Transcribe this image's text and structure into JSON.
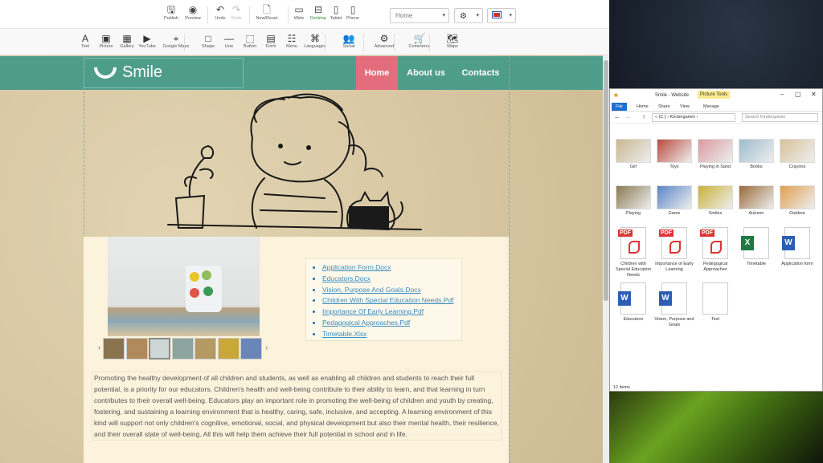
{
  "toolbar": {
    "top": [
      {
        "label": "Publish",
        "icon": "save-icon"
      },
      {
        "label": "Preview",
        "icon": "eye-icon"
      },
      {
        "label": "Undo",
        "icon": "undo-icon"
      },
      {
        "label": "Redo",
        "icon": "redo-icon"
      },
      {
        "label": "New/Reset",
        "icon": "new-page-icon"
      },
      {
        "label": "Wide",
        "icon": "monitor-icon"
      },
      {
        "label": "Desktop",
        "icon": "laptop-icon"
      },
      {
        "label": "Tablet",
        "icon": "tablet-icon"
      },
      {
        "label": "Phone",
        "icon": "phone-icon"
      }
    ],
    "page_select": "Home",
    "insert": [
      {
        "label": "Text",
        "icon": "text-icon",
        "glyph": "A"
      },
      {
        "label": "Picture",
        "icon": "picture-icon",
        "glyph": "▣"
      },
      {
        "label": "Gallery",
        "icon": "gallery-icon",
        "glyph": "▦"
      },
      {
        "label": "YouTube",
        "icon": "youtube-icon",
        "glyph": "▶"
      },
      {
        "label": "Google Maps",
        "icon": "map-pin-icon",
        "glyph": "⌖"
      },
      {
        "label": "Shape",
        "icon": "shape-icon",
        "glyph": "□"
      },
      {
        "label": "Line",
        "icon": "line-icon",
        "glyph": "—"
      },
      {
        "label": "Button",
        "icon": "button-icon",
        "glyph": "⬚"
      },
      {
        "label": "Form",
        "icon": "form-icon",
        "glyph": "▤"
      },
      {
        "label": "Menu",
        "icon": "menu-icon",
        "glyph": "☷"
      },
      {
        "label": "Languages",
        "icon": "languages-icon",
        "glyph": "⌘"
      },
      {
        "label": "Social",
        "icon": "social-icon",
        "glyph": "👥"
      },
      {
        "label": "Advanced",
        "icon": "gears-icon",
        "glyph": "⚙"
      },
      {
        "label": "Commerce",
        "icon": "cart-icon",
        "glyph": "🛒"
      },
      {
        "label": "Maps",
        "icon": "map-icon",
        "glyph": "🗺"
      }
    ]
  },
  "site": {
    "logo": "Smile",
    "nav": [
      "Home",
      "About us",
      "Contacts"
    ],
    "documents": [
      "Application Form.Docx",
      "Educators.Docx",
      "Vision, Purpose And Goals.Docx",
      "Children With Special Education Needs.Pdf",
      "Importance Of Early Learning.Pdf",
      "Pedagogical Approaches.Pdf",
      "Timetable.Xlsx"
    ],
    "paragraph": "Promoting the healthy development of all children and students, as well as enabling all children and students to reach their full potential, is a priority for our educators. Children's health and well-being contribute to their ability to learn, and that learning in turn contributes to their overall well-being. Educators play an important role in promoting the well-being of children and youth by creating, fostering, and sustaining a learning environment that is healthy, caring, safe, inclusive, and accepting. A learning environment of this kind will support not only children's cognitive, emotional, social, and physical development but also their mental health, their resilience, and their overall state of well-being. All this will help them achieve their full potential in school and in life."
  },
  "explorer": {
    "title": "Smile - Website",
    "context_tab": "Picture Tools",
    "ribbon": [
      "File",
      "Home",
      "Share",
      "View",
      "Manage"
    ],
    "path": "« (C:) › Kindergarten ›",
    "search_placeholder": "Search Kindergarten",
    "items": [
      {
        "name": "Girl",
        "kind": "image",
        "color": "#c9b78e"
      },
      {
        "name": "Toys",
        "kind": "image",
        "color": "#b94a3a"
      },
      {
        "name": "Playing in Sand",
        "kind": "image",
        "color": "#d99aa0"
      },
      {
        "name": "Books",
        "kind": "image",
        "color": "#9dbbcc"
      },
      {
        "name": "Crayons",
        "kind": "image",
        "color": "#d7c29a"
      },
      {
        "name": "Playing",
        "kind": "image",
        "color": "#8a7a52"
      },
      {
        "name": "Game",
        "kind": "image",
        "color": "#5a86c6"
      },
      {
        "name": "Smiles",
        "kind": "image",
        "color": "#c9b23a"
      },
      {
        "name": "Autumn",
        "kind": "image",
        "color": "#9a6a3a"
      },
      {
        "name": "Outdoor",
        "kind": "image",
        "color": "#e0a050"
      },
      {
        "name": "Children with Special Education Needs",
        "kind": "pdf"
      },
      {
        "name": "Importance of Early Learning",
        "kind": "pdf"
      },
      {
        "name": "Pedegogical Approaches",
        "kind": "pdf"
      },
      {
        "name": "Timetable",
        "kind": "xlsx"
      },
      {
        "name": "Application form",
        "kind": "docx"
      },
      {
        "name": "Educators",
        "kind": "docx"
      },
      {
        "name": "Vision, Purpose and Goals",
        "kind": "docx"
      },
      {
        "name": "Text",
        "kind": "txt"
      }
    ],
    "status": "12 items"
  },
  "colors": {
    "nav": "#4e9d8b",
    "nav_active": "#e36d7c",
    "link": "#3a8cc0"
  }
}
